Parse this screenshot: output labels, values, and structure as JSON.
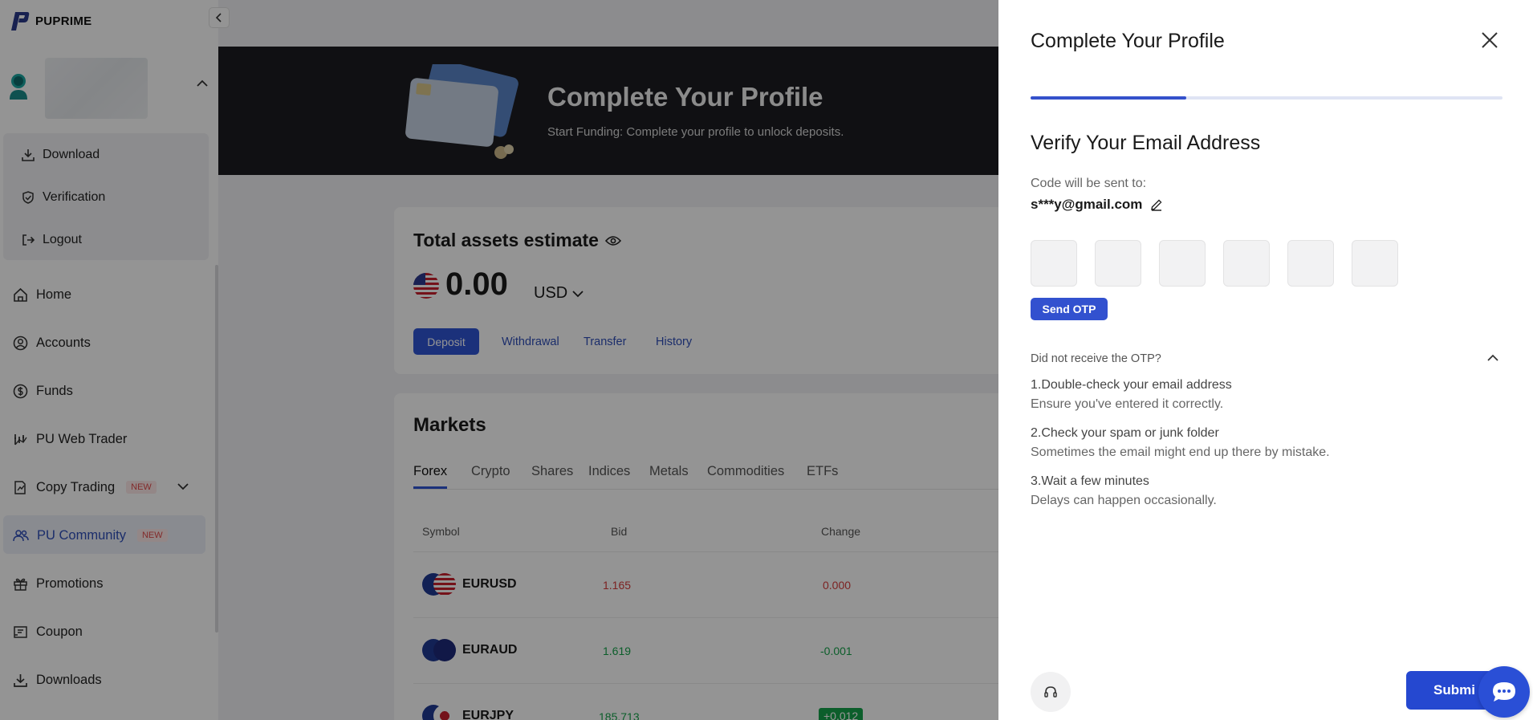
{
  "brand": {
    "name": "PUPRIME",
    "accent": "#2f55d4"
  },
  "user_menu": {
    "items": [
      {
        "label": "Download",
        "icon": "download-icon"
      },
      {
        "label": "Verification",
        "icon": "shield-icon"
      },
      {
        "label": "Logout",
        "icon": "logout-icon"
      }
    ]
  },
  "nav": {
    "items": [
      {
        "label": "Home",
        "icon": "home-icon"
      },
      {
        "label": "Accounts",
        "icon": "user-circle-icon"
      },
      {
        "label": "Funds",
        "icon": "dollar-icon"
      },
      {
        "label": "PU Web Trader",
        "icon": "chart-icon"
      },
      {
        "label": "Copy Trading",
        "icon": "copy-icon",
        "badge": "NEW"
      },
      {
        "label": "PU Community",
        "icon": "community-icon",
        "badge": "NEW",
        "active": true
      },
      {
        "label": "Promotions",
        "icon": "gift-icon"
      },
      {
        "label": "Coupon",
        "icon": "coupon-icon"
      },
      {
        "label": "Downloads",
        "icon": "download-icon"
      }
    ]
  },
  "banner": {
    "title": "Complete Your Profile",
    "subtitle": "Start Funding: Complete your profile to unlock deposits."
  },
  "assets": {
    "title": "Total assets estimate",
    "amount": "0.00",
    "currency": "USD",
    "actions": {
      "deposit": "Deposit",
      "withdrawal": "Withdrawal",
      "transfer": "Transfer",
      "history": "History"
    }
  },
  "markets": {
    "title": "Markets",
    "tabs": [
      "Forex",
      "Crypto",
      "Shares",
      "Indices",
      "Metals",
      "Commodities",
      "ETFs"
    ],
    "active_tab": "Forex",
    "columns": {
      "symbol": "Symbol",
      "bid": "Bid",
      "change": "Change"
    },
    "rows": [
      {
        "symbol": "EURUSD",
        "bid": "1.165",
        "change": "0.000",
        "color": "#d63b3b"
      },
      {
        "symbol": "EURAUD",
        "bid": "1.619",
        "change": "-0.001",
        "color": "#16a34a"
      },
      {
        "symbol": "EURJPY",
        "bid": "185.713",
        "change": "+0.012",
        "color": "#16a34a"
      }
    ]
  },
  "drawer": {
    "title": "Complete Your Profile",
    "progress": 0.33,
    "heading": "Verify Your Email Address",
    "code_label": "Code will be sent to:",
    "email": "s***y@gmail.com",
    "otp_length": 6,
    "send_otp": "Send OTP",
    "help_question": "Did not receive the OTP?",
    "tips": [
      {
        "title": "1.Double-check your email address",
        "desc": "Ensure you've entered it correctly."
      },
      {
        "title": "2.Check your spam or junk folder",
        "desc": "Sometimes the email might end up there by mistake."
      },
      {
        "title": "3.Wait a few minutes",
        "desc": "Delays can happen occasionally."
      }
    ],
    "submit": "Submi"
  }
}
